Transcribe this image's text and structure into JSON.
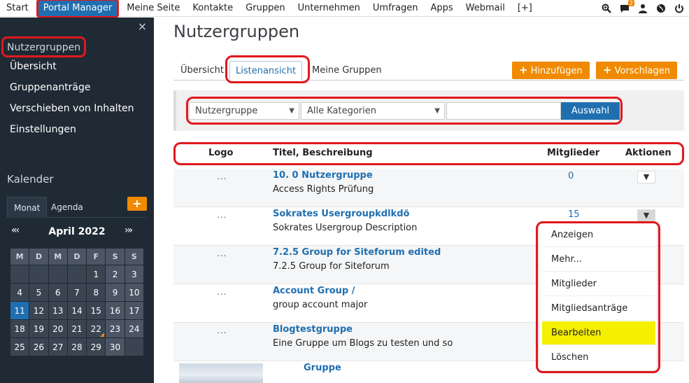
{
  "topnav": {
    "items": [
      "Start",
      "Portal Manager",
      "Meine Seite",
      "Kontakte",
      "Gruppen",
      "Unternehmen",
      "Umfragen",
      "Apps",
      "Webmail",
      "[+]"
    ],
    "active": "Portal Manager",
    "icons": [
      "zoom-icon",
      "chat-icon",
      "user-icon",
      "globe-icon",
      "power-icon"
    ],
    "notification_count": "2"
  },
  "sidebar": {
    "close_glyph": "×",
    "title": "Nutzergruppen",
    "items": [
      "Übersicht",
      "Gruppenanträge",
      "Verschieben von Inhalten",
      "Einstellungen"
    ],
    "calendar": {
      "title": "Kalender",
      "tabs": [
        "Monat",
        "Agenda"
      ],
      "add_glyph": "+",
      "prev_glyph": "«‹",
      "next_glyph": "›»",
      "month_label": "April 2022",
      "weekdays": [
        "M",
        "D",
        "M",
        "D",
        "F",
        "S",
        "S"
      ],
      "weeks": [
        [
          "",
          "",
          "",
          "",
          "1",
          "2",
          "3"
        ],
        [
          "4",
          "5",
          "6",
          "7",
          "8",
          "9",
          "10"
        ],
        [
          "11",
          "12",
          "13",
          "14",
          "15",
          "16",
          "17"
        ],
        [
          "18",
          "19",
          "20",
          "21",
          "22",
          "23",
          "24"
        ],
        [
          "25",
          "26",
          "27",
          "28",
          "29",
          "30",
          ""
        ]
      ],
      "today": "11",
      "marked_day": "22"
    }
  },
  "main": {
    "title": "Nutzergruppen",
    "tabs": [
      "Übersicht",
      "Listenansicht",
      "Meine Gruppen"
    ],
    "active_tab": "Listenansicht",
    "buttons": {
      "add": "Hinzufügen",
      "suggest": "Vorschlagen",
      "plus": "+"
    },
    "filter": {
      "type_value": "Nutzergruppe",
      "category_value": "Alle Kategorien",
      "search_value": "",
      "submit_label": "Auswahl"
    },
    "table": {
      "headers": {
        "logo": "Logo",
        "title": "Titel, Beschreibung",
        "members": "Mitglieder",
        "actions": "Aktionen"
      },
      "rows": [
        {
          "logo": "...",
          "title": "10. 0 Nutzergruppe",
          "desc": "Access Rights Prüfung",
          "members": "0"
        },
        {
          "logo": "...",
          "title": "Sokrates Usergroupkdlkdö",
          "desc": "Sokrates Usergroup Description",
          "members": "15"
        },
        {
          "logo": "...",
          "title": "7.2.5 Group for Siteforum edited",
          "desc": "7.2.5 Group for Siteforum",
          "members": ""
        },
        {
          "logo": "...",
          "title": "Account Group /",
          "desc": "group account major",
          "members": ""
        },
        {
          "logo": "...",
          "title": "Blogtestgruppe",
          "desc": "Eine Gruppe um Blogs zu testen und so",
          "members": ""
        },
        {
          "logo": "",
          "title": "Gruppe",
          "desc": "",
          "members": ""
        }
      ]
    },
    "action_menu": {
      "items": [
        "Anzeigen",
        "Mehr...",
        "Mitglieder",
        "Mitgliedsanträge",
        "Bearbeiten",
        "Löschen"
      ],
      "highlighted": "Bearbeiten"
    }
  },
  "colors": {
    "brand_blue": "#1f6fb0",
    "orange": "#f08a00",
    "sidebar_bg": "#1f2a35",
    "annotation_red": "#e0181f",
    "menu_highlight": "#f5ef00"
  }
}
